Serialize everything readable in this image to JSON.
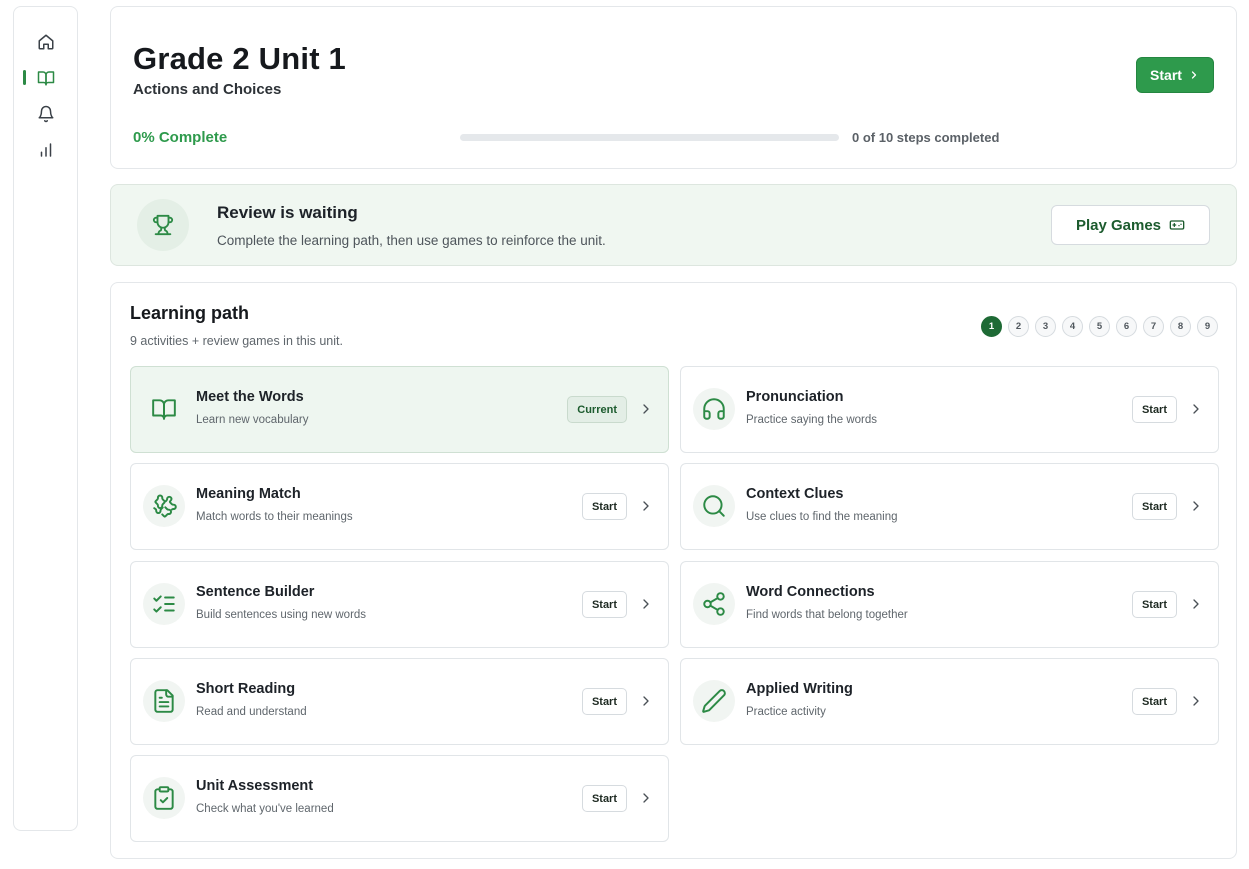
{
  "sidebar": {
    "items": [
      {
        "icon": "home-icon"
      },
      {
        "icon": "book-open-icon",
        "active": true
      },
      {
        "icon": "bell-icon"
      },
      {
        "icon": "bar-chart-icon"
      }
    ]
  },
  "header": {
    "title": "Grade 2 Unit 1",
    "subtitle": "Actions and Choices",
    "start_label": "Start",
    "progress_label": "0% Complete",
    "progress_fraction": 0,
    "steps_label": "0 of 10 steps completed"
  },
  "review": {
    "title": "Review is waiting",
    "description": "Complete the learning path, then use games to reinforce the unit.",
    "button_label": "Play Games"
  },
  "path": {
    "title": "Learning path",
    "description": "9 activities + review games in this unit.",
    "pages": [
      "1",
      "2",
      "3",
      "4",
      "5",
      "6",
      "7",
      "8",
      "9"
    ],
    "active_page": "1",
    "activities": [
      {
        "title": "Meet the Words",
        "description": "Learn new vocabulary",
        "badge": "Current",
        "icon": "book-open-icon"
      },
      {
        "title": "Pronunciation",
        "description": "Practice saying the words",
        "badge": "Start",
        "icon": "headphones-icon"
      },
      {
        "title": "Meaning Match",
        "description": "Match words to their meanings",
        "badge": "Start",
        "icon": "puzzle-icon"
      },
      {
        "title": "Context Clues",
        "description": "Use clues to find the meaning",
        "badge": "Start",
        "icon": "search-icon"
      },
      {
        "title": "Sentence Builder",
        "description": "Build sentences using new words",
        "badge": "Start",
        "icon": "list-checks-icon"
      },
      {
        "title": "Word Connections",
        "description": "Find words that belong together",
        "badge": "Start",
        "icon": "share-icon"
      },
      {
        "title": "Short Reading",
        "description": "Read and understand",
        "badge": "Start",
        "icon": "file-text-icon"
      },
      {
        "title": "Applied Writing",
        "description": "Practice activity",
        "badge": "Start",
        "icon": "pencil-icon"
      },
      {
        "title": "Unit Assessment",
        "description": "Check what you've learned",
        "badge": "Start",
        "icon": "clipboard-check-icon"
      }
    ]
  },
  "colors": {
    "accent": "#2e9a4c",
    "accent_dark": "#1e6a35",
    "current_bg": "#eef6f0",
    "review_bg": "#f0f7f1"
  }
}
